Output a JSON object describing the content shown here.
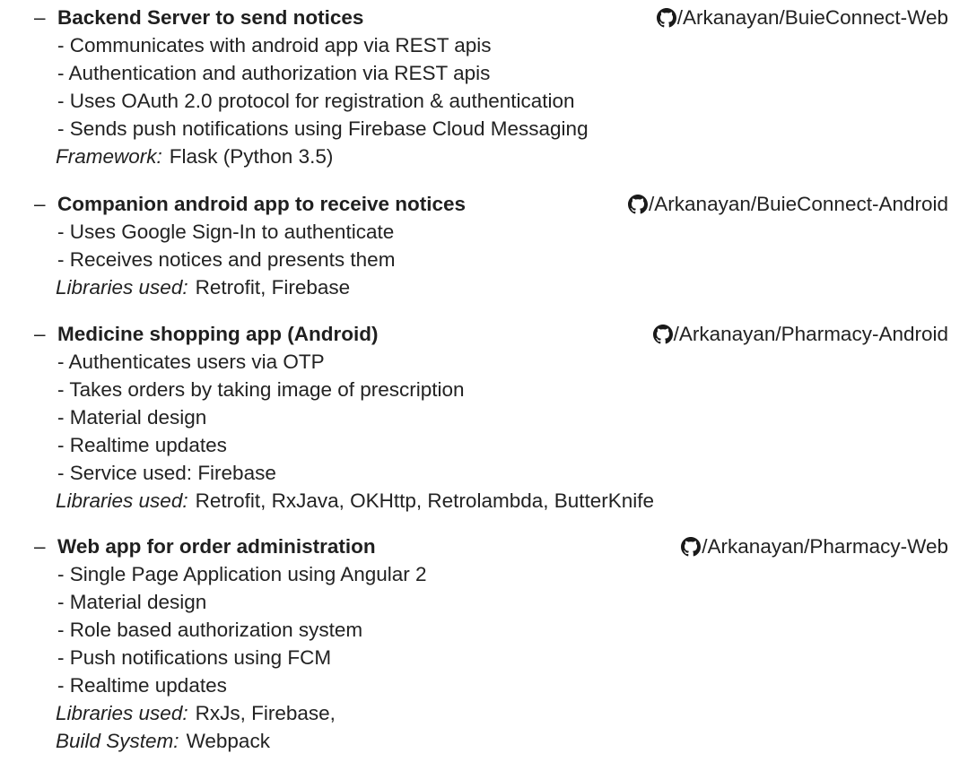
{
  "projects": [
    {
      "dash": "–",
      "title": "Backend Server to send notices",
      "repo_icon": "github-icon",
      "repo": "/Arkanayan/BuieConnect-Web",
      "bullets": [
        "- Communicates with android app via REST apis",
        "- Authentication and authorization via REST apis",
        "- Uses OAuth 2.0 protocol for registration & authentication",
        "- Sends push notifications using Firebase Cloud Messaging"
      ],
      "meta": [
        {
          "label": "Framework:",
          "value": "Flask (Python 3.5)"
        }
      ]
    },
    {
      "dash": "–",
      "title": "Companion android app to receive notices",
      "repo_icon": "github-icon",
      "repo": "/Arkanayan/BuieConnect-Android",
      "bullets": [
        "- Uses Google Sign-In to authenticate",
        "- Receives notices and presents them"
      ],
      "meta": [
        {
          "label": "Libraries used:",
          "value": "Retrofit, Firebase"
        }
      ]
    },
    {
      "dash": "–",
      "title": "Medicine shopping app (Android)",
      "repo_icon": "github-icon",
      "repo": "/Arkanayan/Pharmacy-Android",
      "bullets": [
        "- Authenticates users via OTP",
        "- Takes orders by taking image of prescription",
        "- Material design",
        "- Realtime updates",
        "- Service used: Firebase"
      ],
      "meta": [
        {
          "label": "Libraries used:",
          "value": "Retrofit, RxJava, OKHttp, Retrolambda, ButterKnife"
        }
      ]
    },
    {
      "dash": "–",
      "title": "Web app for order administration",
      "repo_icon": "github-icon",
      "repo": "/Arkanayan/Pharmacy-Web",
      "bullets": [
        "- Single Page Application using Angular 2",
        "- Material design",
        "- Role based authorization system",
        "- Push notifications using FCM",
        "- Realtime updates"
      ],
      "meta": [
        {
          "label": "Libraries used:",
          "value": "RxJs, Firebase,"
        },
        {
          "label": "Build System:",
          "value": "Webpack"
        }
      ]
    }
  ]
}
